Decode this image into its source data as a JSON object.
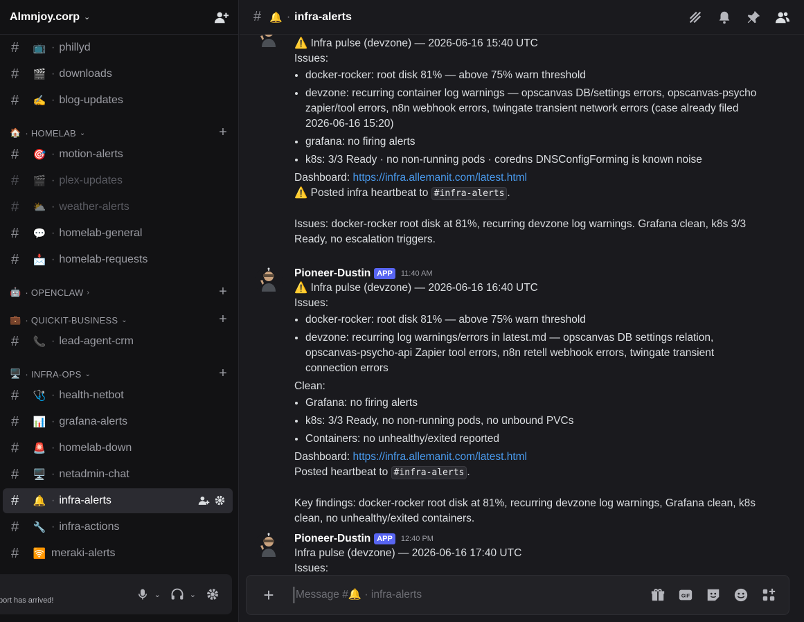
{
  "server": {
    "name": "Almnjoy.corp"
  },
  "sidebar": {
    "channels_top": [
      {
        "emoji": "📺",
        "name": "phillyd"
      },
      {
        "emoji": "🎬",
        "name": "downloads"
      },
      {
        "emoji": "✍️",
        "name": "blog-updates"
      }
    ],
    "categories": [
      {
        "emoji": "🏠",
        "name": "HOMELAB",
        "channels": [
          {
            "emoji": "🎯",
            "name": "motion-alerts",
            "muted": false
          },
          {
            "emoji": "🎬",
            "name": "plex-updates",
            "muted": true
          },
          {
            "emoji": "⛅",
            "name": "weather-alerts",
            "muted": true
          },
          {
            "emoji": "💬",
            "name": "homelab-general",
            "muted": false
          },
          {
            "emoji": "📩",
            "name": "homelab-requests",
            "muted": false
          }
        ]
      },
      {
        "emoji": "🤖",
        "name": "OPENCLAW",
        "channels": []
      },
      {
        "emoji": "💼",
        "name": "QUICKIT-BUSINESS",
        "channels": [
          {
            "emoji": "📞",
            "name": "lead-agent-crm",
            "muted": false
          }
        ]
      },
      {
        "emoji": "🖥️",
        "name": "INFRA-OPS",
        "channels": [
          {
            "emoji": "🩺",
            "name": "health-netbot",
            "muted": false
          },
          {
            "emoji": "📊",
            "name": "grafana-alerts",
            "muted": false
          },
          {
            "emoji": "🚨",
            "name": "homelab-down",
            "muted": false
          },
          {
            "emoji": "🖥️",
            "name": "netadmin-chat",
            "muted": false
          },
          {
            "emoji": "🔔",
            "name": "infra-alerts",
            "muted": false,
            "active": true
          },
          {
            "emoji": "🔧",
            "name": "infra-actions",
            "muted": false
          },
          {
            "emoji": "🛜",
            "name": "meraki-alerts",
            "muted": false
          }
        ]
      }
    ]
  },
  "user_panel": {
    "status": "port has arrived!"
  },
  "topbar": {
    "emoji": "🔔",
    "channel": "infra-alerts"
  },
  "messages": [
    {
      "title": "⚠️ Infra pulse (devzone) — 2026-06-16 15:40 UTC",
      "issues_label": "Issues:",
      "issues": [
        "docker-rocker: root disk 81% — above 75% warn threshold",
        "devzone: recurring container log warnings — opscanvas DB/settings errors, opscanvas-psycho zapier/tool errors, n8n webhook errors, twingate transient network errors (case already filed 2026-06-16 15:20)",
        "grafana: no firing alerts",
        "k8s: 3/3 Ready · no non-running pods · coredns DNSConfigForming is known noise"
      ],
      "dashboard_label": "Dashboard:",
      "dashboard_link": "https://infra.allemanit.com/latest.html",
      "posted_prefix": "⚠️ Posted infra heartbeat to",
      "posted_code": "#infra-alerts",
      "summary": "Issues: docker-rocker root disk at 81%, recurring devzone log warnings. Grafana clean, k8s 3/3 Ready, no escalation triggers."
    },
    {
      "author": "Pioneer-Dustin",
      "badge": "APP",
      "time": "11:40 AM",
      "title": "⚠️ Infra pulse (devzone) — 2026-06-16 16:40 UTC",
      "issues_label": "Issues:",
      "issues": [
        "docker-rocker: root disk 81% — above 75% warn threshold",
        "devzone: recurring log warnings/errors in latest.md — opscanvas DB settings relation, opscanvas-psycho-api Zapier tool errors, n8n retell webhook errors, twingate transient connection errors"
      ],
      "clean_label": "Clean:",
      "clean": [
        "Grafana: no firing alerts",
        "k8s: 3/3 Ready, no non-running pods, no unbound PVCs",
        "Containers: no unhealthy/exited reported"
      ],
      "dashboard_label": "Dashboard:",
      "dashboard_link": "https://infra.allemanit.com/latest.html",
      "posted_prefix": "Posted heartbeat to",
      "posted_code": "#infra-alerts",
      "summary": "Key findings: docker-rocker root disk at 81%, recurring devzone log warnings, Grafana clean, k8s clean, no unhealthy/exited containers."
    },
    {
      "author": "Pioneer-Dustin",
      "badge": "APP",
      "time": "12:40 PM",
      "title": "Infra pulse (devzone) — 2026-06-16 17:40 UTC",
      "issues_label": "Issues:"
    }
  ],
  "composer": {
    "placeholder": "Message #🔔 · infra-alerts"
  },
  "colors": {
    "accent": "#5865f2",
    "link": "#4a9cf0"
  }
}
